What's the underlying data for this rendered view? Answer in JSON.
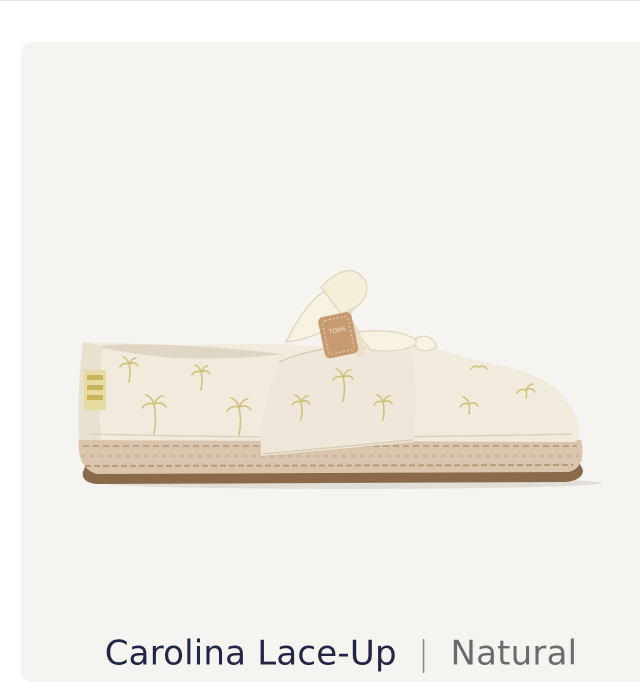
{
  "product": {
    "name": "Carolina Lace-Up",
    "separator": "|",
    "color": "Natural",
    "image_icon": "espadrille-shoe-icon",
    "tag_text": "TOMS"
  },
  "colors": {
    "card_bg": "#f6f4f0",
    "name_text": "#212546",
    "variant_text": "#6b6b6b"
  }
}
